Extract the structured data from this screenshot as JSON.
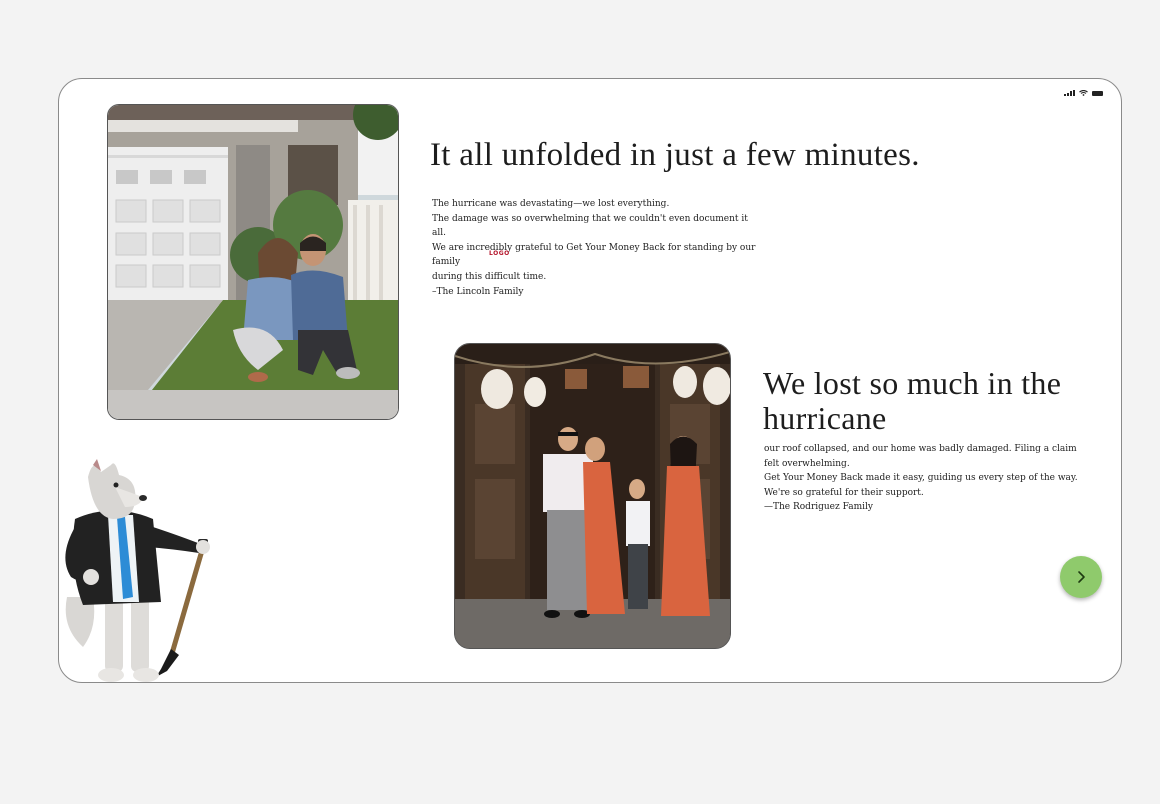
{
  "testimonials": [
    {
      "headline": "It all unfolded in just a few minutes.",
      "quote_lines": [
        "The hurricane was devastating—we lost everything.",
        "The damage was so overwhelming that we couldn't even document it all.",
        "We are incredibly grateful to Get Your Money Back for standing by our family",
        "during this difficult time.",
        "–The Lincoln Family"
      ],
      "logo_text": "LOGO",
      "photo_icon": "family-photo-couple-icon"
    },
    {
      "headline": "We lost so much in the hurricane",
      "quote_lines": [
        "our roof collapsed, and our home was badly damaged. Filing a claim felt overwhelming.",
        "Get Your Money Back made it easy, guiding us every step of the way. We're so grateful for their support.",
        "—The Rodriguez Family"
      ],
      "photo_icon": "family-photo-four-icon"
    }
  ],
  "navigation": {
    "next_icon": "chevron-right-icon"
  },
  "status_bar": {
    "icons": [
      "signal-icon",
      "wifi-icon",
      "battery-icon"
    ]
  },
  "mascot": {
    "icon": "wolf-mascot-with-shovel-icon"
  },
  "colors": {
    "page_background": "#f3f3f3",
    "card_background": "#ffffff",
    "next_button": "#8fca6c",
    "logo_accent": "#b4142a",
    "text": "#1f1f1f"
  }
}
